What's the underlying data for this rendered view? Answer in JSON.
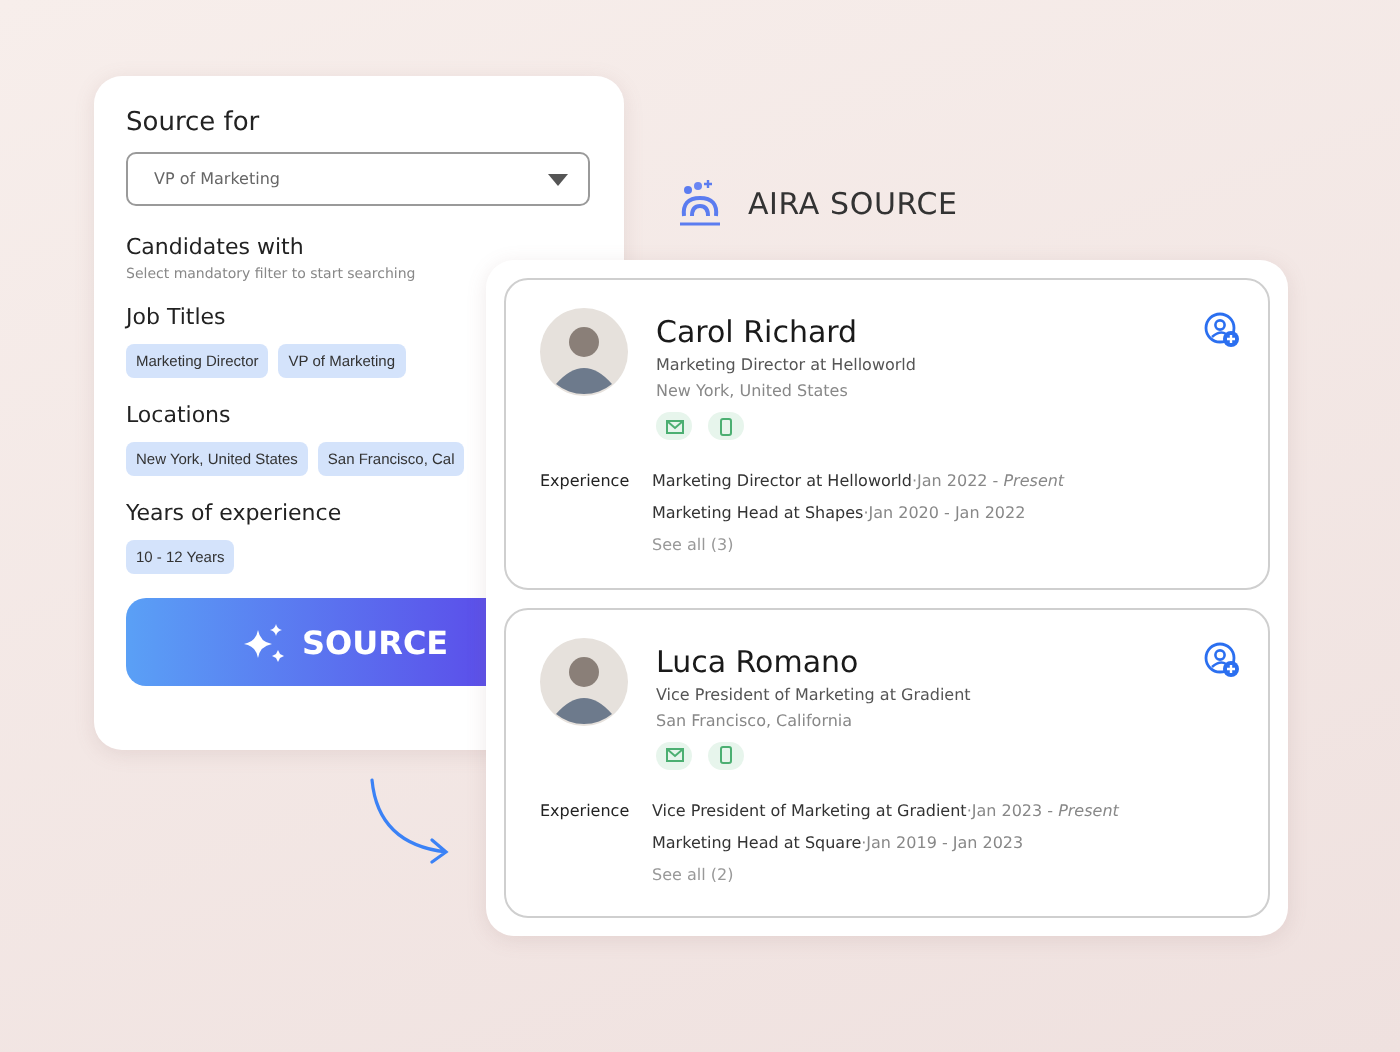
{
  "filter_card": {
    "title": "Source for",
    "dropdown": {
      "value": "VP of Marketing"
    },
    "subtitle": "Candidates with",
    "hint": "Select mandatory filter to start searching",
    "sections": [
      {
        "label": "Job Titles",
        "chips": [
          "Marketing Director",
          "VP of Marketing"
        ]
      },
      {
        "label": "Locations",
        "chips": [
          "New York, United States",
          "San Francisco, Cal"
        ]
      },
      {
        "label": "Years of experience",
        "chips": [
          "10 - 12 Years"
        ]
      }
    ],
    "button": "SOURCE"
  },
  "brand": {
    "name": "AIRA SOURCE"
  },
  "candidates": [
    {
      "name": "Carol Richard",
      "headline": "Marketing Director at Helloworld",
      "location": "New York, United States",
      "experience_label": "Experience",
      "experience": [
        {
          "role": "Marketing Director at Helloworld",
          "dates": "·Jan 2022 - *Present*"
        },
        {
          "role": "Marketing Head at Shapes",
          "dates": "·Jan 2020 - Jan 2022"
        }
      ],
      "see_all": "See all (3)"
    },
    {
      "name": "Luca Romano",
      "headline": "Vice President of Marketing at Gradient",
      "location": "San Francisco, California",
      "experience_label": "Experience",
      "experience": [
        {
          "role": "Vice President of Marketing at Gradient",
          "dates": "·Jan 2023 - *Present*"
        },
        {
          "role": "Marketing Head at Square",
          "dates": "·Jan 2019 - Jan 2023"
        }
      ],
      "see_all": "See all (2)"
    }
  ]
}
